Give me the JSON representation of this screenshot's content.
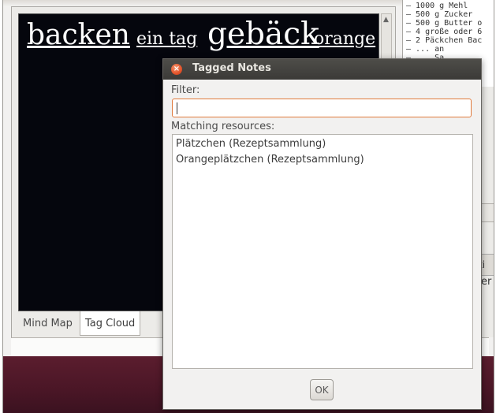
{
  "tag_cloud": {
    "tags": [
      "backen",
      "ein tag",
      "gebäck",
      "orange"
    ]
  },
  "tabs": [
    "Mind Map",
    "Tag Cloud"
  ],
  "right_panel": {
    "recipe_lines": [
      "– 1000 g Mehl",
      "– 500 g Zucker",
      "– 500 g Butter o",
      "– 4 große oder 6",
      "– 2 Päckchen Bac",
      "– ... an",
      "– ... Sa"
    ],
    "button_partial": "ti",
    "text_partial": "er"
  },
  "dialog": {
    "title": "Tagged Notes",
    "filter_label": "Filter:",
    "filter_value": "",
    "matching_label": "Matching resources:",
    "resources": [
      "Plätzchen (Rezeptsammlung)",
      "Orangeplätzchen (Rezeptsammlung)"
    ],
    "ok_label": "OK"
  },
  "colors": {
    "cloud_bg": "#05060d",
    "accent_focus": "#e07a3c",
    "close_button": "#e2532a",
    "desktop": "#4a1626"
  }
}
